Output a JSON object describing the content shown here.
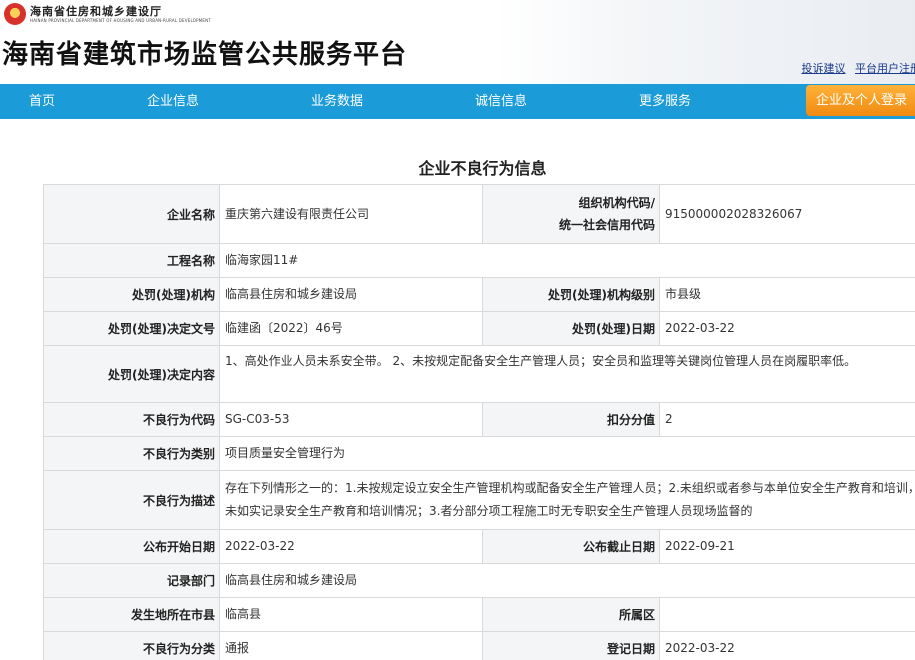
{
  "header": {
    "dept_name": "海南省住房和城乡建设厅",
    "dept_name_en": "HAINAN PROVINCIAL DEPARTMENT OF HOUSING AND URBAN-RURAL DEVELOPMENT",
    "site_title": "海南省建筑市场监管公共服务平台",
    "links": [
      "投诉建议",
      "平台用户注册"
    ]
  },
  "nav": {
    "items": [
      "首页",
      "企业信息",
      "业务数据",
      "诚信信息",
      "更多服务"
    ],
    "login_label": "企业及个人登录"
  },
  "page_title": "企业不良行为信息",
  "record": {
    "company_name_label": "企业名称",
    "company_name": "重庆第六建设有限责任公司",
    "org_code_label_1": "组织机构代码/",
    "org_code_label_2": "统一社会信用代码",
    "org_code": "915000002028326067",
    "project_label": "工程名称",
    "project": "临海家园11#",
    "authority_label": "处罚(处理)机构",
    "authority": "临高县住房和城乡建设局",
    "authority_level_label": "处罚(处理)机构级别",
    "authority_level": "市县级",
    "decision_no_label": "处罚(处理)决定文号",
    "decision_no": "临建函〔2022〕46号",
    "decision_date_label": "处罚(处理)日期",
    "decision_date": "2022-03-22",
    "decision_content_label": "处罚(处理)决定内容",
    "decision_content": "1、高处作业人员未系安全带。 2、未按规定配备安全生产管理人员；安全员和监理等关键岗位管理人员在岗履职率低。",
    "code_label": "不良行为代码",
    "code": "SG-C03-53",
    "score_label": "扣分分值",
    "score": "2",
    "category_label": "不良行为类别",
    "category": "项目质量安全管理行为",
    "description_label": "不良行为描述",
    "description": "存在下列情形之一的：1.未按规定设立安全生产管理机构或配备安全生产管理人员；2.未组织或者参与本单位安全生产教育和培训，未如实记录安全生产教育和培训情况；3.者分部分项工程施工时无专职安全生产管理人员现场监督的",
    "publish_start_label": "公布开始日期",
    "publish_start": "2022-03-22",
    "publish_end_label": "公布截止日期",
    "publish_end": "2022-09-21",
    "record_dept_label": "记录部门",
    "record_dept": "临高县住房和城乡建设局",
    "city_label": "发生地所在市县",
    "city": "临高县",
    "district_label": "所属区",
    "district": "",
    "classification_label": "不良行为分类",
    "classification": "通报",
    "register_date_label": "登记日期",
    "register_date": "2022-03-22"
  },
  "colors": {
    "nav_bg": "#1b9bd8",
    "login_bg": "#f5a020",
    "label_bg": "#f4f5f7",
    "border": "#d9d9d9"
  }
}
